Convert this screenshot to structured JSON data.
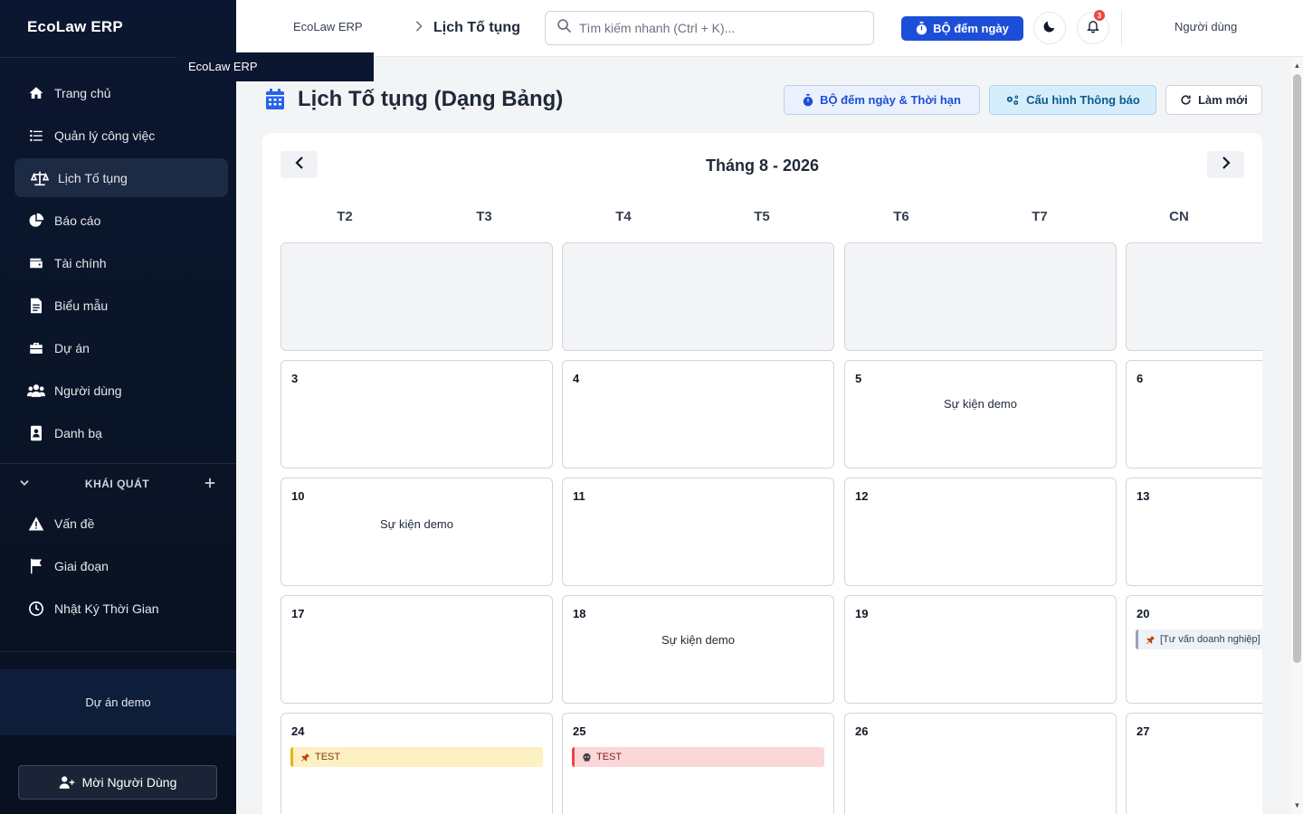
{
  "app": {
    "brand": "EcoLaw ERP",
    "tooltip": "EcoLaw ERP"
  },
  "sidebar": {
    "items": [
      {
        "label": "Trang chủ",
        "icon": "home-icon"
      },
      {
        "label": "Quản lý công việc",
        "icon": "tasks-icon"
      },
      {
        "label": "Lịch Tố tụng",
        "icon": "scale-icon",
        "active": true
      },
      {
        "label": "Báo cáo",
        "icon": "pie-chart-icon"
      },
      {
        "label": "Tài chính",
        "icon": "wallet-icon"
      },
      {
        "label": "Biểu mẫu",
        "icon": "document-icon"
      },
      {
        "label": "Dự án",
        "icon": "briefcase-icon"
      },
      {
        "label": "Người dùng",
        "icon": "users-icon"
      },
      {
        "label": "Danh bạ",
        "icon": "contact-book-icon"
      }
    ],
    "section": {
      "title": "KHÁI QUÁT"
    },
    "section_items": [
      {
        "label": "Vấn đề",
        "icon": "warning-icon"
      },
      {
        "label": "Giai đoạn",
        "icon": "flag-icon"
      },
      {
        "label": "Nhật Ký Thời Gian",
        "icon": "clock-icon"
      }
    ],
    "project": "Dự án demo",
    "invite_label": "Mời Người Dùng"
  },
  "topbar": {
    "breadcrumb_root": "EcoLaw ERP",
    "breadcrumb_current": "Lịch Tố tụng",
    "search_placeholder": "Tìm kiếm nhanh (Ctrl + K)...",
    "counter_label": "BỘ đếm ngày",
    "notification_count": "3",
    "user_label": "Người dùng"
  },
  "page": {
    "title": "Lịch Tố tụng (Dạng Bảng)",
    "btn_counter": "BỘ đếm ngày & Thời hạn",
    "btn_config": "Cấu hình Thông báo",
    "btn_refresh": "Làm mới"
  },
  "calendar": {
    "month_label": "Tháng 8 - 2026",
    "weekdays": [
      "T2",
      "T3",
      "T4",
      "T5",
      "T6",
      "T7",
      "CN"
    ],
    "rows": [
      [
        {
          "day": "",
          "events": []
        },
        {
          "day": "",
          "events": []
        },
        {
          "day": "",
          "events": []
        },
        {
          "day": "",
          "events": []
        }
      ],
      [
        {
          "day": "3",
          "events": []
        },
        {
          "day": "4",
          "events": []
        },
        {
          "day": "5",
          "events": [
            {
              "type": "text",
              "label": "Sự kiện demo"
            }
          ]
        },
        {
          "day": "6",
          "events": []
        }
      ],
      [
        {
          "day": "10",
          "events": [
            {
              "type": "text",
              "label": "Sự kiện demo"
            }
          ]
        },
        {
          "day": "11",
          "events": []
        },
        {
          "day": "12",
          "events": []
        },
        {
          "day": "13",
          "events": []
        }
      ],
      [
        {
          "day": "17",
          "events": []
        },
        {
          "day": "18",
          "events": [
            {
              "type": "text",
              "label": "Sự kiện demo"
            }
          ]
        },
        {
          "day": "19",
          "events": []
        },
        {
          "day": "20",
          "events": [
            {
              "type": "chip",
              "color": "grey",
              "icon": "pushpin-icon",
              "label": "[Tư vấn doanh nghiệp]"
            }
          ]
        }
      ],
      [
        {
          "day": "24",
          "events": [
            {
              "type": "chip",
              "color": "yellow",
              "icon": "pushpin-icon",
              "label": "TEST"
            }
          ]
        },
        {
          "day": "25",
          "events": [
            {
              "type": "chip",
              "color": "red",
              "icon": "skull-icon",
              "label": "TEST"
            }
          ]
        },
        {
          "day": "26",
          "events": []
        },
        {
          "day": "27",
          "events": []
        }
      ]
    ]
  }
}
